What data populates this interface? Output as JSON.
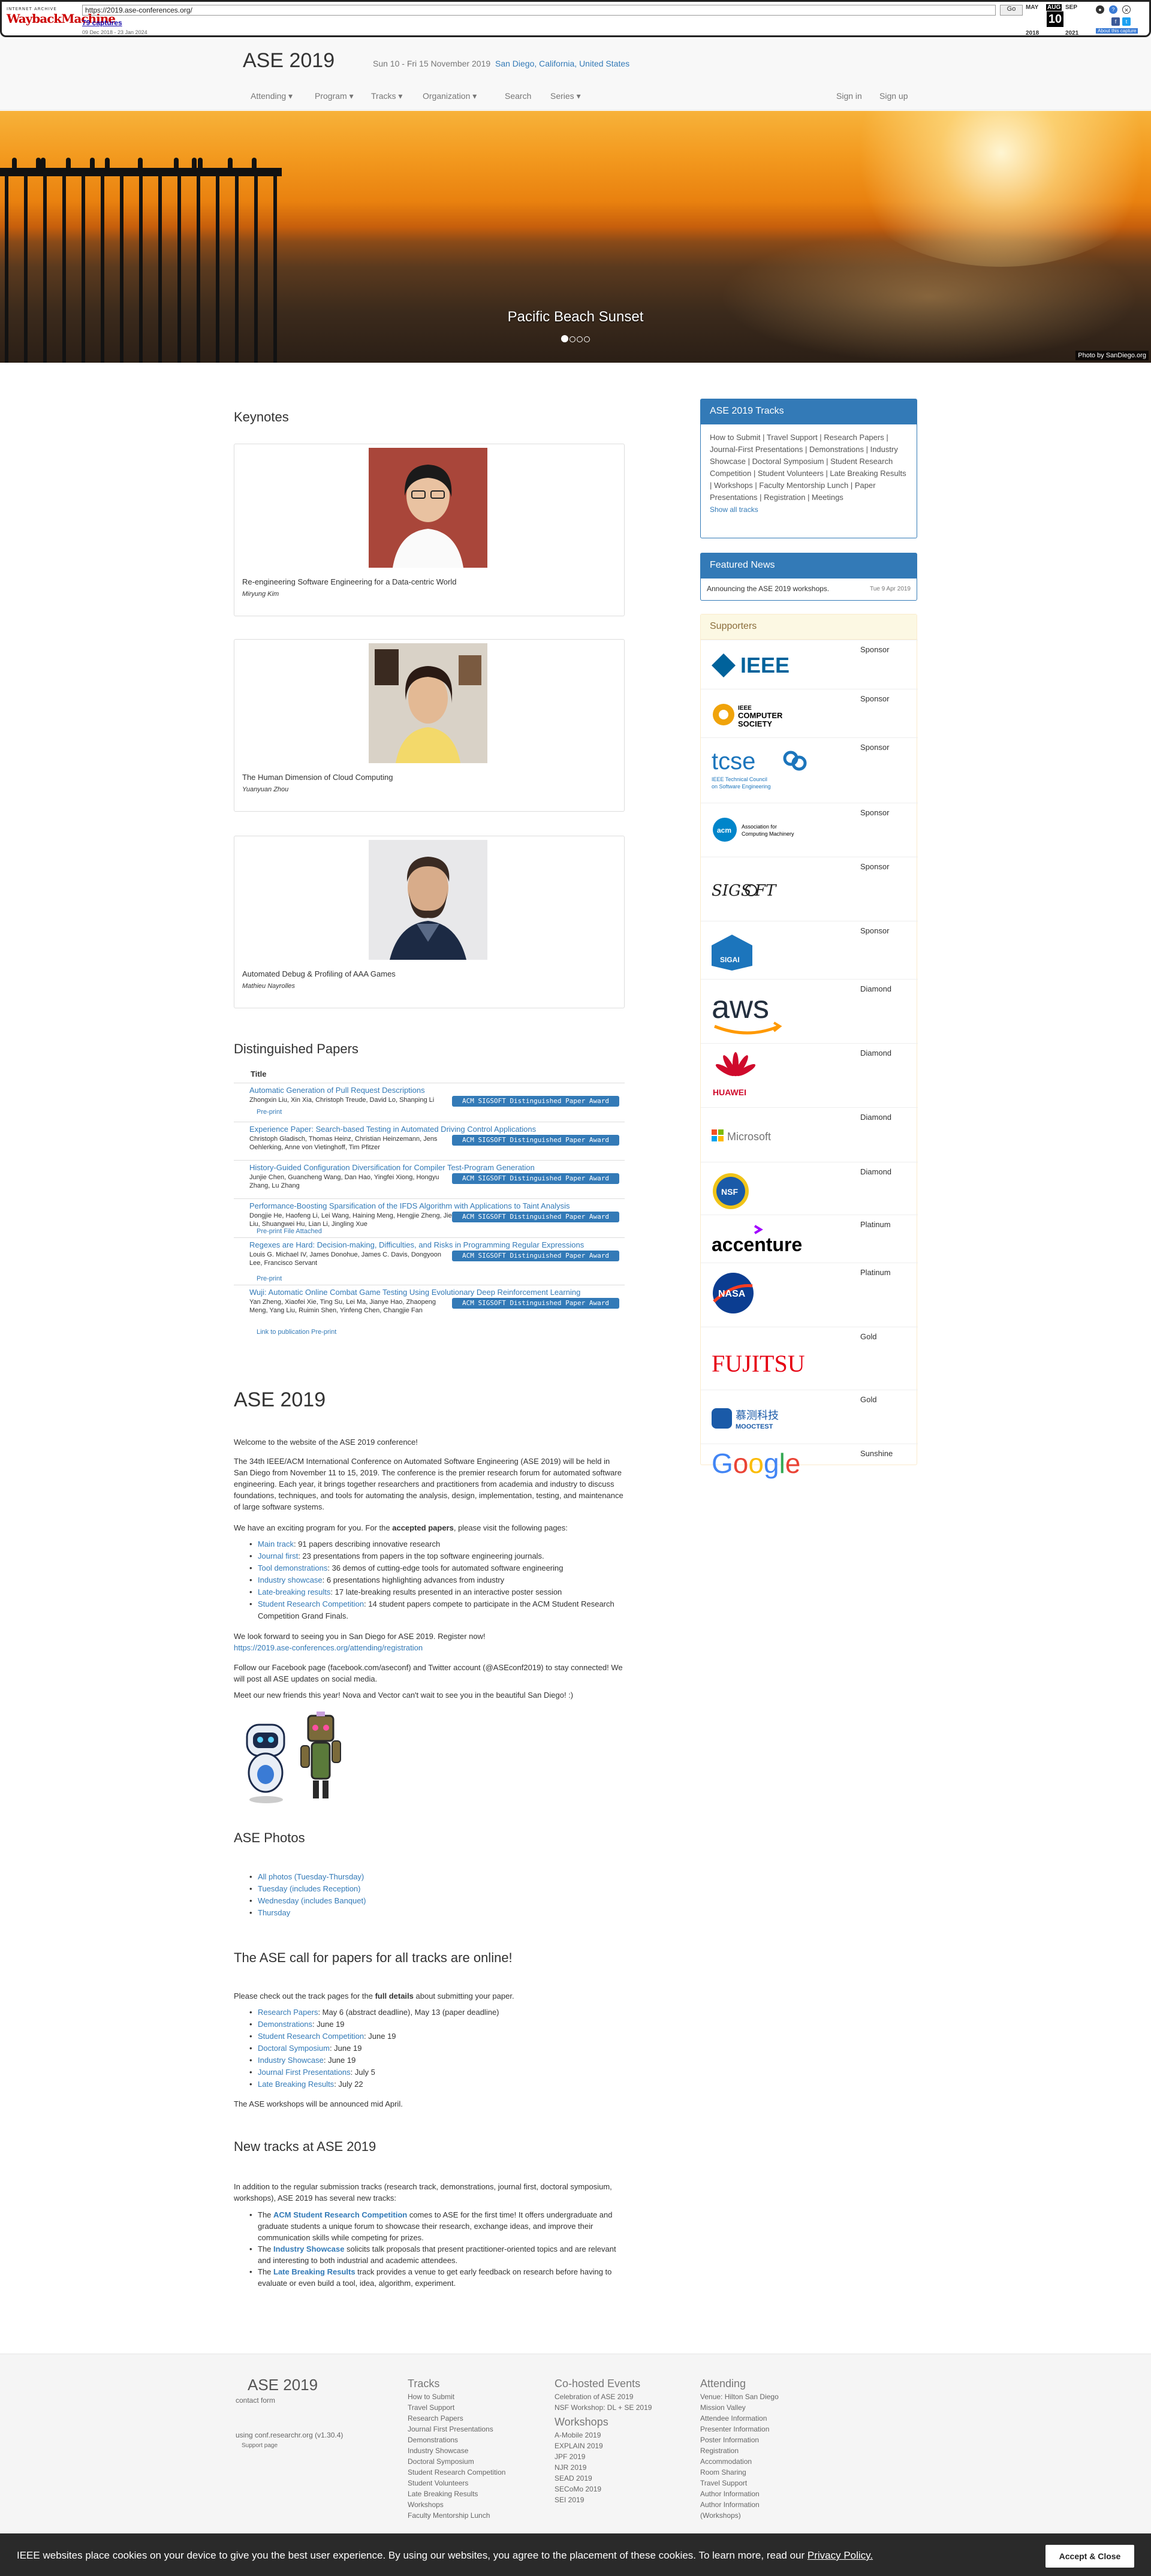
{
  "wayback": {
    "url": "https://2019.ase-conferences.org/",
    "go_label": "Go",
    "captures": "79 captures",
    "range": "09 Dec 2018 - 23 Jan 2024",
    "months": [
      "MAY",
      "AUG",
      "SEP"
    ],
    "years": [
      "2018",
      "2020",
      "2021"
    ],
    "day": "10",
    "about": "About this capture"
  },
  "header": {
    "brand": "ASE 2019",
    "dates": "Sun 10 - Fri 15 November 2019",
    "location": "San Diego, California, United States",
    "nav": [
      "Attending ▾",
      "Program ▾",
      "Tracks ▾",
      "Organization ▾",
      "Search",
      "Series ▾"
    ],
    "sign_in": "Sign in",
    "sign_up": "Sign up"
  },
  "hero": {
    "caption": "Pacific Beach Sunset",
    "credit": "Photo by SanDiego.org"
  },
  "keynotes": {
    "heading": "Keynotes",
    "items": [
      {
        "title": "Re-engineering Software Engineering for a Data-centric World",
        "speaker": "Miryung Kim"
      },
      {
        "title": "The Human Dimension of Cloud Computing",
        "speaker": "Yuanyuan Zhou"
      },
      {
        "title": "Automated Debug & Profiling of AAA Games",
        "speaker": "Mathieu Nayrolles"
      }
    ]
  },
  "distinguished": {
    "heading": "Distinguished Papers",
    "col_title": "Title",
    "award": "ACM SIGSOFT Distinguished Paper Award",
    "papers": [
      {
        "title": "Automatic Generation of Pull Request Descriptions",
        "authors": "Zhongxin Liu, Xin Xia, Christoph Treude, David Lo, Shanping Li",
        "links": "Pre-print"
      },
      {
        "title": "Experience Paper: Search-based Testing in Automated Driving Control Applications",
        "authors": "Christoph Gladisch, Thomas Heinz, Christian Heinzemann, Jens Oehlerking, Anne von Vietinghoff, Tim Pfitzer",
        "links": ""
      },
      {
        "title": "History-Guided Configuration Diversification for Compiler Test-Program Generation",
        "authors": "Junjie Chen, Guancheng Wang, Dan Hao, Yingfei Xiong, Hongyu Zhang, Lu Zhang",
        "links": ""
      },
      {
        "title": "Performance-Boosting Sparsification of the IFDS Algorithm with Applications to Taint Analysis",
        "authors": "Dongjie He, Haofeng Li, Lei Wang, Haining Meng, Hengjie Zheng, Jie Liu, Shuangwei Hu, Lian Li, Jingling Xue",
        "links": "Pre-print     File Attached"
      },
      {
        "title": "Regexes are Hard: Decision-making, Difficulties, and Risks in Programming Regular Expressions",
        "authors": "Louis G. Michael IV, James Donohue, James C. Davis, Dongyoon Lee, Francisco Servant",
        "links": "Pre-print"
      },
      {
        "title": "Wuji: Automatic Online Combat Game Testing Using Evolutionary Deep Reinforcement Learning",
        "authors": "Yan Zheng, Xiaofei Xie, Ting Su, Lei Ma, Jianye Hao, Zhaopeng Meng, Yang Liu, Ruimin Shen, Yinfeng Chen, Changjie Fan",
        "links": "Link to publication     Pre-print"
      }
    ]
  },
  "about": {
    "heading": "ASE 2019",
    "welcome": "Welcome to the website of the ASE 2019 conference!",
    "intro": "The 34th IEEE/ACM International Conference on Automated Software Engineering (ASE 2019) will be held in San Diego from November 11 to 15, 2019. The conference is the premier research forum for automated software engineering. Each year, it brings together researchers and practitioners from academia and industry to discuss foundations, techniques, and tools for automating the analysis, design, implementation, testing, and maintenance of large software systems.",
    "program_pre": "We have an exciting program for you. For the ",
    "program_bold": "accepted papers",
    "program_post": ", please visit the following pages:",
    "tracks": [
      {
        "name": "Main track",
        "desc": ": 91 papers describing innovative research"
      },
      {
        "name": "Journal first",
        "desc": ": 23 presentations from papers in the top software engineering journals."
      },
      {
        "name": "Tool demonstrations",
        "desc": ": 36 demos of cutting-edge tools for automated software engineering"
      },
      {
        "name": "Industry showcase",
        "desc": ": 6 presentations highlighting advances from industry"
      },
      {
        "name": "Late-breaking results",
        "desc": ": 17 late-breaking results presented in an interactive poster session"
      },
      {
        "name": "Student Research Competition",
        "desc": ": 14 student papers compete to participate in the ACM Student Research Competition Grand Finals."
      }
    ],
    "register": "We look forward to seeing you in San Diego for ASE 2019. Register now!",
    "register_link": "https://2019.ase-conferences.org/attending/registration",
    "social": "Follow our Facebook page (facebook.com/aseconf) and Twitter account (@ASEconf2019) to stay connected! We will post all ASE updates on social media.",
    "mascots": "Meet our new friends this year! Nova and Vector can't wait to see you in the beautiful San Diego! :)"
  },
  "photos": {
    "heading": "ASE Photos",
    "items": [
      "All photos (Tuesday-Thursday)",
      "Tuesday (includes Reception)",
      "Wednesday (includes Banquet)",
      "Thursday"
    ]
  },
  "cfp": {
    "heading": "The ASE call for papers for all tracks are online!",
    "intro_pre": "Please check out the track pages for the ",
    "intro_bold": "full details",
    "intro_post": " about submitting your paper.",
    "items": [
      {
        "name": "Research Papers",
        "desc": ": May 6 (abstract deadline), May 13 (paper deadline)"
      },
      {
        "name": "Demonstrations",
        "desc": ": June 19"
      },
      {
        "name": "Student Research Competition",
        "desc": ": June 19"
      },
      {
        "name": "Doctoral Symposium",
        "desc": ": June 19"
      },
      {
        "name": "Industry Showcase",
        "desc": ": June 19"
      },
      {
        "name": "Journal First Presentations",
        "desc": ": July 5"
      },
      {
        "name": "Late Breaking Results",
        "desc": ": July 22"
      }
    ],
    "workshops": "The ASE workshops will be announced mid April."
  },
  "newtracks": {
    "heading": "New tracks at ASE 2019",
    "intro": "In addition to the regular submission tracks (research track, demonstrations, journal first, doctoral symposium, workshops), ASE 2019 has several new tracks:",
    "items": [
      {
        "pre": "The ",
        "name": "ACM Student Research Competition",
        "desc": " comes to ASE for the first time! It offers undergraduate and graduate students a unique forum to showcase their research, exchange ideas, and improve their communication skills while competing for prizes."
      },
      {
        "pre": "The ",
        "name": "Industry Showcase",
        "desc": " solicits talk proposals that present practitioner-oriented topics and are relevant and interesting to both industrial and academic attendees."
      },
      {
        "pre": "The ",
        "name": "Late Breaking Results",
        "desc": " track provides a venue to get early feedback on research before having to evaluate or even build a tool, idea, algorithm, experiment."
      }
    ]
  },
  "sidebar": {
    "tracks_heading": "ASE 2019 Tracks",
    "tracks_text": "How to Submit | Travel Support | Research Papers | Journal-First Presentations | Demonstrations | Industry Showcase | Doctoral Symposium | Student Research Competition | Student Volunteers | Late Breaking Results | Workshops | Faculty Mentorship Lunch | Paper Presentations | Registration | Meetings",
    "show_all": "Show all tracks",
    "news_heading": "Featured News",
    "news_item": "Announcing the ASE 2019 workshops.",
    "news_date": "Tue 9 Apr 2019",
    "supporters_heading": "Supporters",
    "supporters": [
      {
        "name": "IEEE",
        "level": "Sponsor"
      },
      {
        "name": "IEEE Computer Society",
        "level": "Sponsor"
      },
      {
        "name": "tcse IEEE Technical Council on Software Engineering",
        "level": "Sponsor"
      },
      {
        "name": "Association for Computing Machinery",
        "level": "Sponsor"
      },
      {
        "name": "SIGSOFT",
        "level": "Sponsor"
      },
      {
        "name": "SIGAI",
        "level": "Sponsor"
      },
      {
        "name": "aws",
        "level": "Diamond"
      },
      {
        "name": "HUAWEI",
        "level": "Diamond"
      },
      {
        "name": "Microsoft",
        "level": "Diamond"
      },
      {
        "name": "NSF",
        "level": "Diamond"
      },
      {
        "name": "accenture",
        "level": "Platinum"
      },
      {
        "name": "NASA",
        "level": "Platinum"
      },
      {
        "name": "FUJITSU",
        "level": "Gold"
      },
      {
        "name": "慕测科技 MOOCTEST",
        "level": "Gold"
      },
      {
        "name": "Google",
        "level": "Sunshine"
      }
    ]
  },
  "footer": {
    "brand": "ASE 2019",
    "contact": "contact form",
    "powered": "using conf.researchr.org (v1.30.4)",
    "support": "Support page",
    "tracks_heading": "Tracks",
    "tracks": [
      "How to Submit",
      "Travel Support",
      "Research Papers",
      "Journal First Presentations",
      "Demonstrations",
      "Industry Showcase",
      "Doctoral Symposium",
      "Student Research Competition",
      "Student Volunteers",
      "Late Breaking Results",
      "Workshops",
      "Faculty Mentorship Lunch"
    ],
    "cohosted_heading": "Co-hosted Events",
    "cohosted": [
      "Celebration of ASE 2019",
      "NSF Workshop: DL + SE 2019"
    ],
    "workshops_heading": "Workshops",
    "workshops": [
      "A-Mobile 2019",
      "EXPLAIN 2019",
      "JPF 2019",
      "NJR 2019",
      "SEAD 2019",
      "SECoMo 2019",
      "SEI 2019"
    ],
    "attending_heading": "Attending",
    "attending": [
      "Venue: Hilton San Diego Mission Valley",
      "Attendee Information",
      "Presenter Information",
      "Poster Information",
      "Registration",
      "Accommodation",
      "Room Sharing",
      "Travel Support",
      "Author Information",
      "Author Information (Workshops)"
    ]
  },
  "cookie": {
    "text": "IEEE websites place cookies on your device to give you the best user experience. By using our websites, you agree to the placement of these cookies. To learn more, read our ",
    "policy": "Privacy Policy.",
    "button": "Accept & Close"
  }
}
